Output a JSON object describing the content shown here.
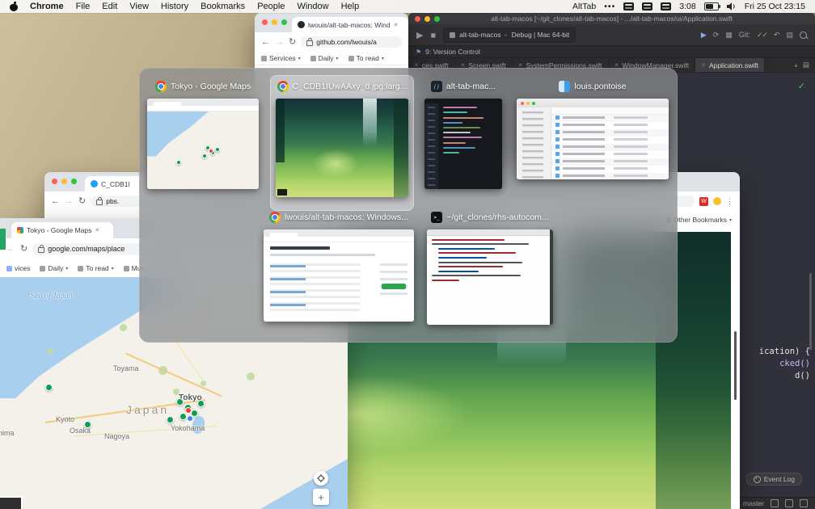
{
  "menu_bar": {
    "left": [
      "Chrome",
      "File",
      "Edit",
      "View",
      "History",
      "Bookmarks",
      "People",
      "Window",
      "Help"
    ],
    "right": {
      "alttab": "AltTab",
      "dots": "•••",
      "badge_time": "3:08",
      "clock": "Fri 25 Oct 23:15"
    }
  },
  "alttab_switcher": {
    "row1": [
      {
        "title": "Tokyo - Google Maps",
        "icon": "chrome"
      },
      {
        "title": "C_CDB1IUwAAxy_d.jpg:larg...",
        "icon": "chrome"
      },
      {
        "title": "alt-tab-mac...",
        "icon": "code-editor"
      },
      {
        "title": "louis.pontoise",
        "icon": "finder"
      }
    ],
    "row2": [
      {
        "title": "lwouis/alt-tab-macos: Windows...",
        "icon": "chrome"
      },
      {
        "title": "~/git_clones/rhs-autocom...",
        "icon": "terminal"
      }
    ]
  },
  "xcode": {
    "title": "alt-tab-macos [~/git_clones/alt-tab-macos] - .../alt-tab-macos/ui/Application.swift",
    "scheme": "alt-tab-macos",
    "destination": "Debug | Mac 64-bit",
    "jump_bar": "9: Version Control",
    "git_label": "Git:",
    "tabs": [
      "ces.swift",
      "Screen.swift",
      "SystemPermissions.swift",
      "WindowManager.swift",
      "Application.swift"
    ],
    "code_lines": [
      "ication) {",
      "cked()",
      "d()"
    ],
    "event_log": "Event Log",
    "branch": "master"
  },
  "chrome_github_window": {
    "tab_title": "lwouis/alt-tab-macos: Wind",
    "url": "github.com/lwouis/a",
    "bookmarks": [
      "Services",
      "Daily",
      "To read"
    ]
  },
  "chrome_image_window": {
    "tab_title": "C_CDB1I",
    "url": "pbs.",
    "other_bookmarks": "Other Bookmarks"
  },
  "chrome_maps_window": {
    "tab_title": "Tokyo - Google Maps",
    "url": "google.com/maps/place",
    "bookmarks": [
      "vices",
      "Daily",
      "To read",
      "Mus"
    ]
  },
  "map": {
    "sea_label": "Sea of Japan",
    "country_label": "Japan",
    "cities": [
      "Toyama",
      "Tokyo",
      "Yokohama",
      "Nagoya",
      "Osaka",
      "Kyoto",
      "hima"
    ]
  },
  "colors": {
    "marker_green": "#0c9d58",
    "selection": "rgba(255,255,255,0.34)"
  }
}
